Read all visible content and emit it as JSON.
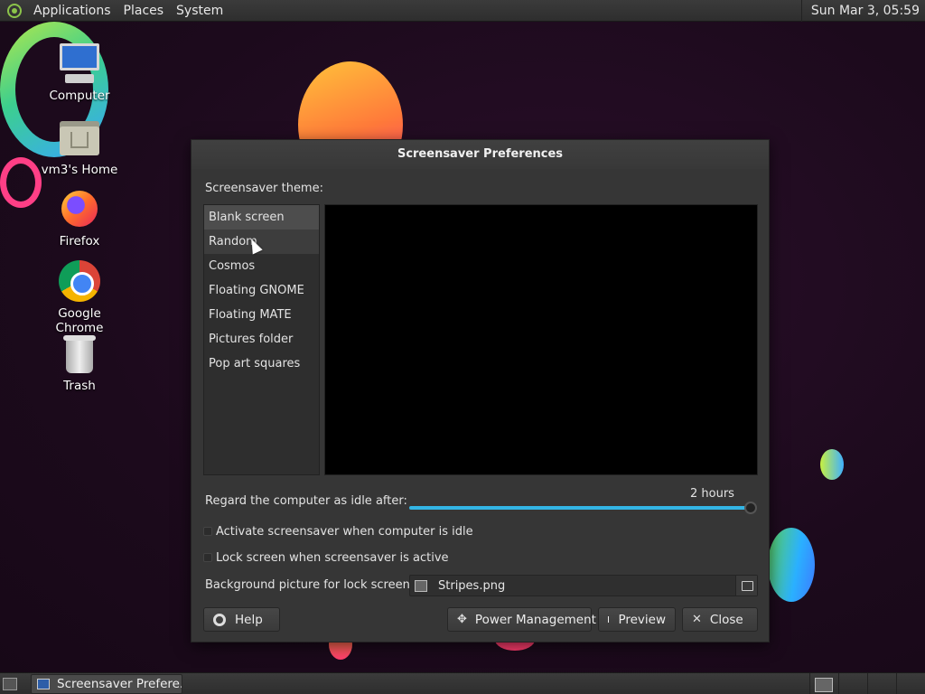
{
  "top_panel": {
    "menus": [
      "Applications",
      "Places",
      "System"
    ],
    "clock": "Sun Mar  3, 05:59"
  },
  "desktop_icons": [
    {
      "label": "Computer",
      "icon": "computer-icon"
    },
    {
      "label": "vm3's Home",
      "icon": "home-folder-icon"
    },
    {
      "label": "Firefox",
      "icon": "firefox-icon"
    },
    {
      "label": "Google Chrome",
      "icon": "chrome-icon"
    },
    {
      "label": "Trash",
      "icon": "trash-icon"
    }
  ],
  "dialog": {
    "title": "Screensaver Preferences",
    "theme_label": "Screensaver theme:",
    "themes": [
      "Blank screen",
      "Random",
      "Cosmos",
      "Floating GNOME",
      "Floating MATE",
      "Pictures folder",
      "Pop art squares"
    ],
    "selected_theme": "Blank screen",
    "idle_label": "Regard the computer as idle after:",
    "idle_value": "2 hours",
    "idle_fraction": 1.0,
    "activate_label": "Activate screensaver when computer is idle",
    "activate_checked": false,
    "lock_label": "Lock screen when screensaver is active",
    "lock_checked": false,
    "bg_label": "Background picture for lock screen:",
    "bg_file": "Stripes.png",
    "buttons": {
      "help": "Help",
      "power": "Power Management",
      "preview": "Preview",
      "close": "Close"
    }
  },
  "taskbar": {
    "task_label": "Screensaver Prefere..."
  },
  "colors": {
    "slider_accent": "#33b5e5",
    "dialog_bg": "#363636"
  }
}
